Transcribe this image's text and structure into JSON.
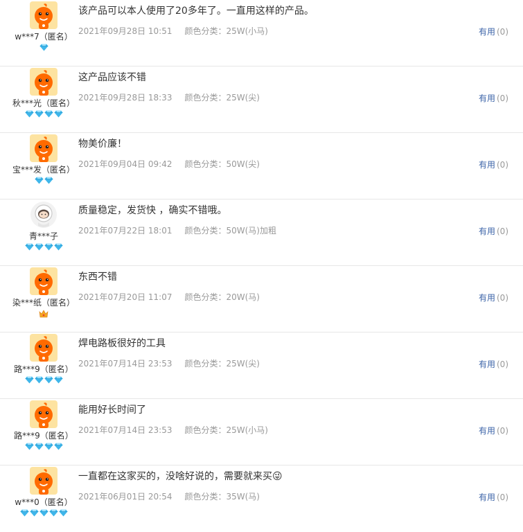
{
  "reviews": [
    {
      "username": "w***7（匿名）",
      "avatar": "mascot",
      "gems": 1,
      "crown": false,
      "content": "该产品可以本人使用了20多年了。一直用这样的产品。",
      "date": "2021年09月28日 10:51",
      "spec": "颜色分类：25W(小马)",
      "useful_label": "有用",
      "useful_count": "(0)"
    },
    {
      "username": "秋***光（匿名）",
      "avatar": "mascot",
      "gems": 4,
      "crown": false,
      "content": "这产品应该不错",
      "date": "2021年09月28日 18:33",
      "spec": "颜色分类：25W(尖)",
      "useful_label": "有用",
      "useful_count": "(0)"
    },
    {
      "username": "宝***发（匿名）",
      "avatar": "mascot",
      "gems": 2,
      "crown": false,
      "content": "物美价廉！",
      "date": "2021年09月04日 09:42",
      "spec": "颜色分类：50W(尖)",
      "useful_label": "有用",
      "useful_count": "(0)"
    },
    {
      "username": "青***子",
      "avatar": "astronaut",
      "gems": 4,
      "crown": false,
      "content": "质量稳定，发货快 ，确实不错哦。",
      "date": "2021年07月22日 18:01",
      "spec": "颜色分类：50W(马)加粗",
      "useful_label": "有用",
      "useful_count": "(0)"
    },
    {
      "username": "染***纸（匿名）",
      "avatar": "mascot",
      "gems": 0,
      "crown": true,
      "content": "东西不错",
      "date": "2021年07月20日 11:07",
      "spec": "颜色分类：20W(马)",
      "useful_label": "有用",
      "useful_count": "(0)"
    },
    {
      "username": "路***9（匿名）",
      "avatar": "mascot",
      "gems": 4,
      "crown": false,
      "content": "焊电路板很好的工具",
      "date": "2021年07月14日 23:53",
      "spec": "颜色分类：25W(尖)",
      "useful_label": "有用",
      "useful_count": "(0)"
    },
    {
      "username": "路***9（匿名）",
      "avatar": "mascot",
      "gems": 4,
      "crown": false,
      "content": "能用好长时间了",
      "date": "2021年07月14日 23:53",
      "spec": "颜色分类：25W(小马)",
      "useful_label": "有用",
      "useful_count": "(0)"
    },
    {
      "username": "w***0（匿名）",
      "avatar": "mascot",
      "gems": 5,
      "crown": false,
      "content": "一直都在这家买的，没啥好说的，需要就来买😜",
      "date": "2021年06月01日 20:54",
      "spec": "颜色分类：35W(马)",
      "useful_label": "有用",
      "useful_count": "(0)"
    }
  ],
  "colors": {
    "link": "#3c64a8",
    "meta": "#999999",
    "divider": "#e6e6e6",
    "gem": "#3fb6ea",
    "crown": "#f5a623",
    "mascot": "#ff6a00"
  }
}
